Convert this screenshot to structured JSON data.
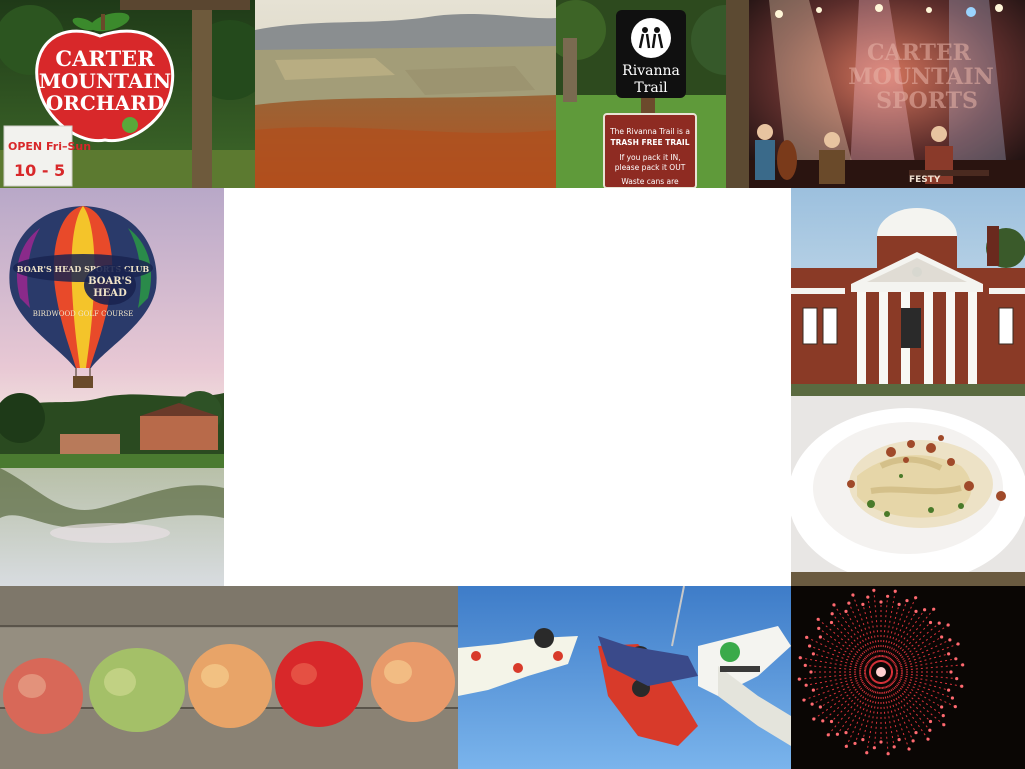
{
  "orchard": {
    "sign_line1": "CARTER",
    "sign_line2": "MOUNTAIN",
    "sign_line3": "ORCHARD",
    "hours_line1": "OPEN Fri–Sun",
    "hours_line2": "10 - 5"
  },
  "trail": {
    "sign_line1": "Rivanna",
    "sign_line2": "Trail",
    "notice_line1": "The Rivanna Trail is a",
    "notice_line2": "TRASH FREE TRAIL",
    "notice_line3": "If you pack it IN,",
    "notice_line4": "please pack it OUT",
    "notice_line5": "Waste cans are"
  },
  "concert": {
    "banner_line1": "CARTER",
    "banner_line2": "MOUNTAIN",
    "banner_line3": "SPORTS",
    "banner_tag": "FESTY"
  },
  "balloon": {
    "band_text": "BOAR'S HEAD SPORTS CLUB",
    "logo_line1": "BOAR'S",
    "logo_line2": "HEAD",
    "lower_text": "BIRDWOOD GOLF COURSE"
  },
  "colors": {
    "apple_red": "#d8282a",
    "trail_brown": "#8e2b22",
    "sky_blue": "#5b9be0",
    "firework_red": "#ff3b45"
  }
}
